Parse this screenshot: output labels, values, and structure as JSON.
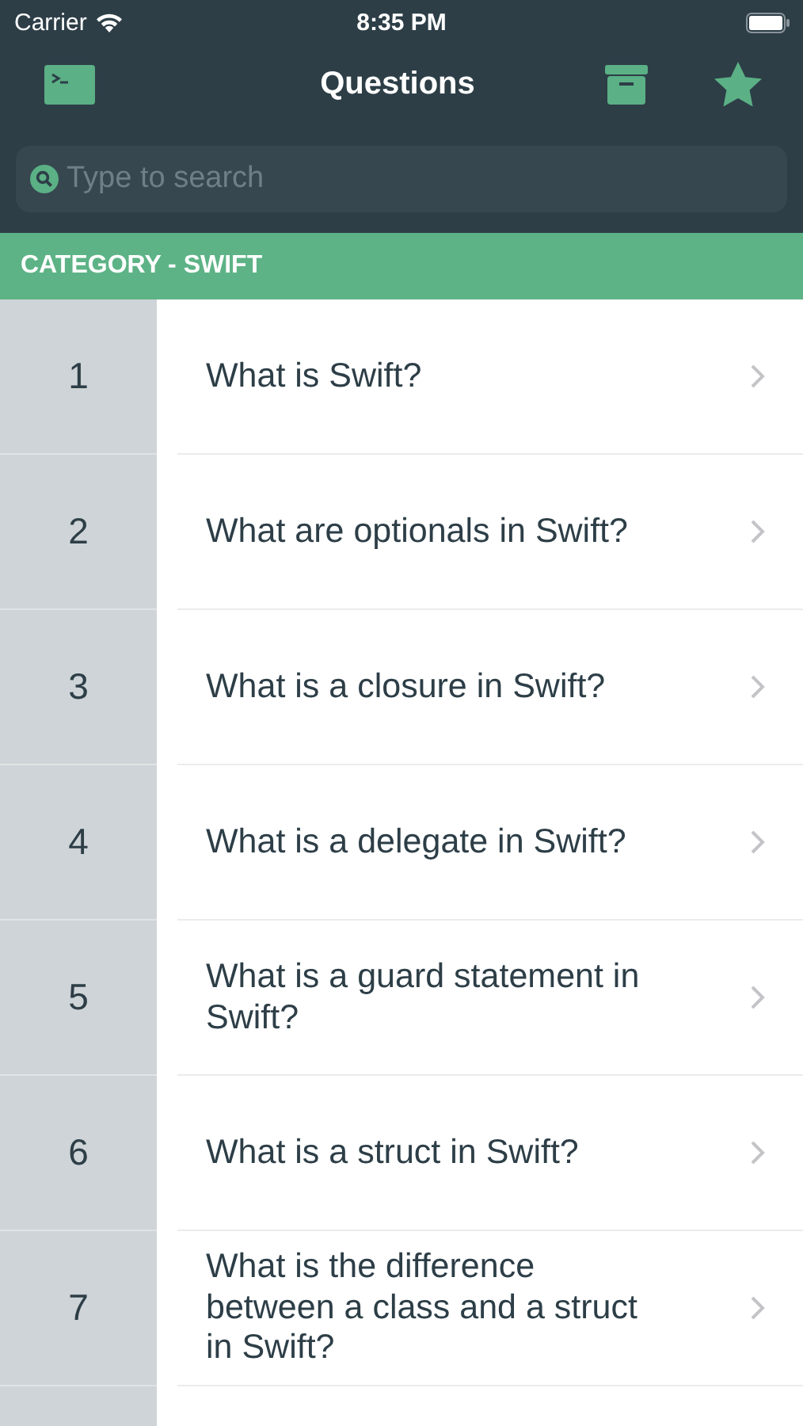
{
  "status_bar": {
    "carrier": "Carrier",
    "time": "8:35 PM"
  },
  "nav": {
    "title": "Questions"
  },
  "search": {
    "placeholder": "Type to search"
  },
  "category": {
    "title": "CATEGORY - SWIFT"
  },
  "questions": [
    {
      "number": "1",
      "text": "What is Swift?"
    },
    {
      "number": "2",
      "text": "What are optionals in Swift?"
    },
    {
      "number": "3",
      "text": "What is a closure in Swift?"
    },
    {
      "number": "4",
      "text": "What is a delegate in Swift?"
    },
    {
      "number": "5",
      "text": "What is a guard statement in Swift?"
    },
    {
      "number": "6",
      "text": "What is a struct in Swift?"
    },
    {
      "number": "7",
      "text": "What is the difference between a class and a struct in Swift?"
    }
  ]
}
